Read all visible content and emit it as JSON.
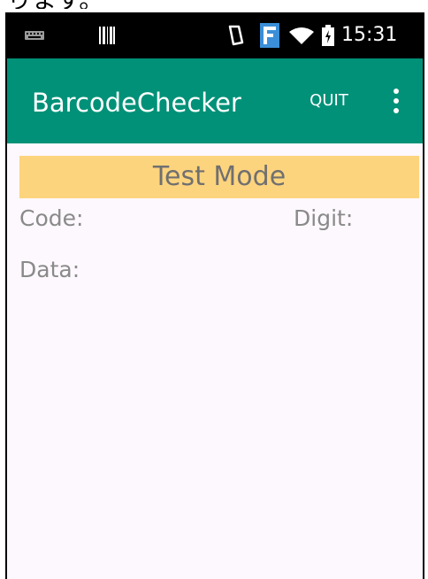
{
  "caption": "ります。",
  "status_bar": {
    "time": "15:31",
    "icons": [
      "keyboard-icon",
      "barcode-icon",
      "screen-rotation-icon",
      "f-app-icon",
      "wifi-icon",
      "battery-icon"
    ]
  },
  "app_bar": {
    "title": "BarcodeChecker",
    "quit_label": "QUIT",
    "overflow_icon": "more-vert-icon",
    "color": "#009178"
  },
  "main": {
    "mode_banner": "Test Mode",
    "mode_banner_color": "#fdd47e",
    "code_label": "Code:",
    "digit_label": "Digit:",
    "data_label": "Data:"
  }
}
